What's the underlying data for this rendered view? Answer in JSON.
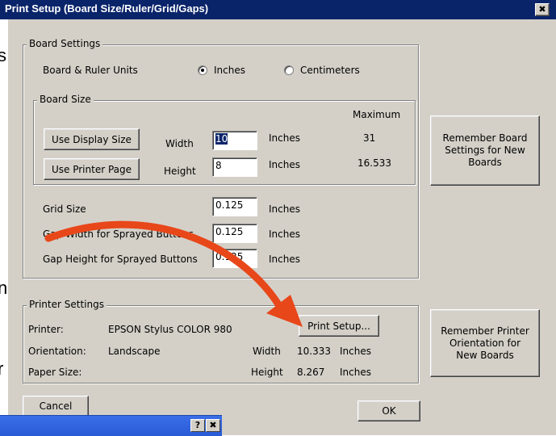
{
  "window": {
    "title": "Print Setup (Board Size/Ruler/Grid/Gaps)",
    "close_glyph": "✖"
  },
  "board_settings": {
    "group_label": "Board Settings",
    "units_label": "Board & Ruler Units",
    "unit_inches": "Inches",
    "unit_centimeters": "Centimeters",
    "selected_unit": "Inches",
    "board_size": {
      "group_label": "Board Size",
      "maximum_header": "Maximum",
      "use_display_size": "Use Display Size",
      "use_printer_page": "Use Printer Page",
      "width_label": "Width",
      "height_label": "Height",
      "width_value": "10",
      "height_value": "8",
      "width_units": "Inches",
      "height_units": "Inches",
      "width_max": "31",
      "height_max": "16.533"
    },
    "grid_size_label": "Grid Size",
    "grid_size_value": "0.125",
    "grid_size_units": "Inches",
    "gap_width_label": "Gap Width for Sprayed Buttons",
    "gap_width_value": "0.125",
    "gap_width_units": "Inches",
    "gap_height_label": "Gap Height for Sprayed Buttons",
    "gap_height_value": "0.125",
    "gap_height_units": "Inches"
  },
  "remember_board_button": "Remember Board Settings for New Boards",
  "printer_settings": {
    "group_label": "Printer Settings",
    "printer_label": "Printer:",
    "printer_value": "EPSON Stylus COLOR 980",
    "print_setup_button": "Print Setup...",
    "orientation_label": "Orientation:",
    "orientation_value": "Landscape",
    "paper_size_label": "Paper Size:",
    "paper_width_label": "Width",
    "paper_width_value": "10.333",
    "paper_width_units": "Inches",
    "paper_height_label": "Height",
    "paper_height_value": "8.267",
    "paper_height_units": "Inches"
  },
  "remember_printer_button": "Remember Printer Orientation for New Boards",
  "cancel_button": "Cancel",
  "ok_button": "OK",
  "background_window": {
    "help_glyph": "?",
    "close_glyph": "✖"
  },
  "side_fragments": [
    "s",
    "n",
    "r"
  ],
  "colors": {
    "titlebar": "#0a246a",
    "dialog_face": "#d4d0c8",
    "arrow": "#e8471a"
  }
}
